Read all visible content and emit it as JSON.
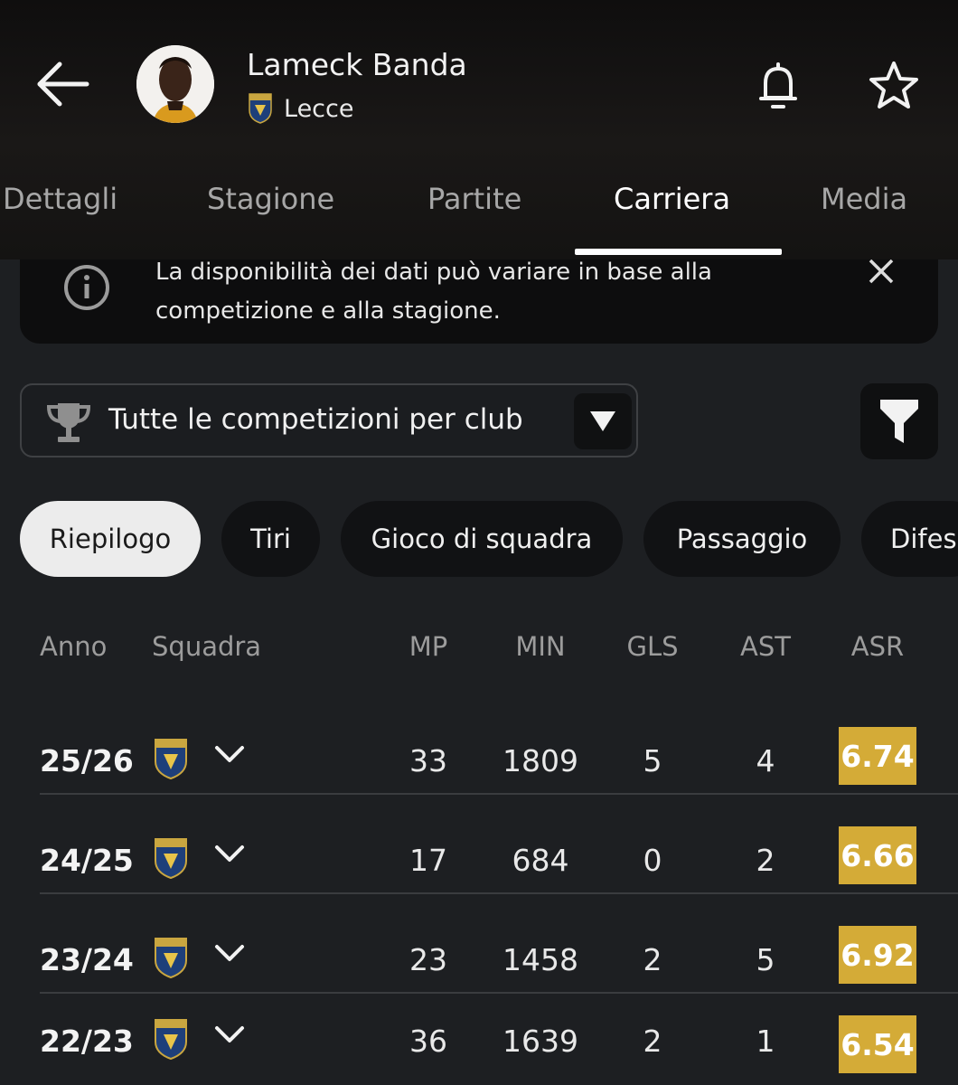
{
  "header": {
    "player_name": "Lameck Banda",
    "club_name": "Lecce",
    "icons": [
      "back-arrow-icon",
      "bell-icon",
      "star-icon"
    ]
  },
  "tabs": [
    {
      "label": "Dettagli",
      "active": false
    },
    {
      "label": "Stagione",
      "active": false
    },
    {
      "label": "Partite",
      "active": false
    },
    {
      "label": "Carriera",
      "active": true
    },
    {
      "label": "Media",
      "active": false
    }
  ],
  "notice": {
    "text_line1": "La disponibilità dei dati può variare in base alla",
    "text_line2": "competizione e alla stagione."
  },
  "competition_filter": {
    "selected": "Tutte le competizioni per club"
  },
  "chips": [
    {
      "label": "Riepilogo",
      "active": true
    },
    {
      "label": "Tiri",
      "active": false
    },
    {
      "label": "Gioco di squadra",
      "active": false
    },
    {
      "label": "Passaggio",
      "active": false
    },
    {
      "label": "Difes",
      "active": false
    }
  ],
  "table": {
    "headers": {
      "year": "Anno",
      "team": "Squadra",
      "mp": "MP",
      "min": "MIN",
      "gls": "GLS",
      "ast": "AST",
      "asr": "ASR"
    },
    "rows": [
      {
        "year": "25/26",
        "mp": "33",
        "min": "1809",
        "gls": "5",
        "ast": "4",
        "asr": "6.74"
      },
      {
        "year": "24/25",
        "mp": "17",
        "min": "684",
        "gls": "0",
        "ast": "2",
        "asr": "6.66"
      },
      {
        "year": "23/24",
        "mp": "23",
        "min": "1458",
        "gls": "2",
        "ast": "5",
        "asr": "6.92"
      },
      {
        "year": "22/23",
        "mp": "36",
        "min": "1639",
        "gls": "2",
        "ast": "1",
        "asr": "6.54"
      }
    ]
  },
  "colors": {
    "background": "#1d1f22",
    "rating_badge": "#d4ab37",
    "active_chip": "#ececec"
  }
}
